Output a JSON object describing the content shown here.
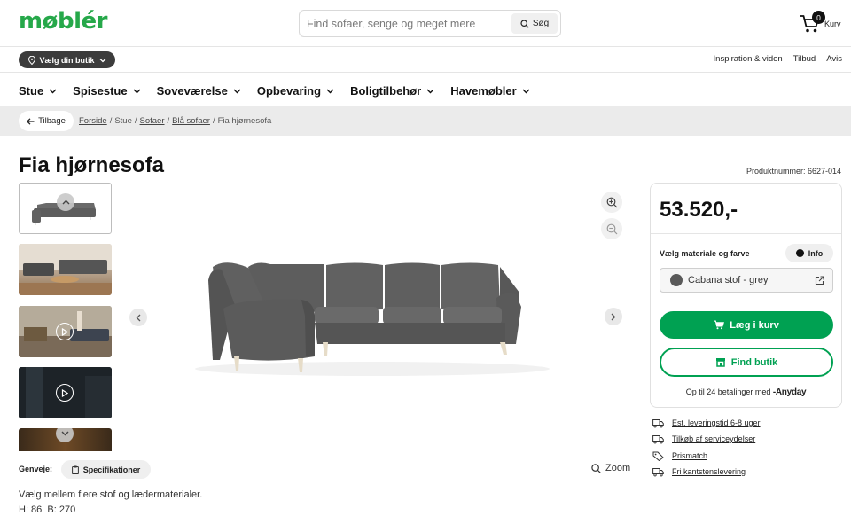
{
  "header": {
    "logo": "møblér",
    "search_placeholder": "Find sofaer, senge og meget mere",
    "search_button": "Søg",
    "cart_count": "0",
    "cart_label": "Kurv"
  },
  "subbar": {
    "store_button": "Vælg din butik",
    "links": [
      "Inspiration & viden",
      "Tilbud",
      "Avis"
    ]
  },
  "nav": [
    "Stue",
    "Spisestue",
    "Soveværelse",
    "Opbevaring",
    "Boligtilbehør",
    "Havemøbler"
  ],
  "breadcrumb": {
    "back": "Tilbage",
    "items": [
      "Forside",
      "Stue",
      "Sofaer",
      "Blå sofaer",
      "Fia hjørnesofa"
    ]
  },
  "product": {
    "title": "Fia hjørnesofa",
    "product_number": "Produktnummer: 6627-014",
    "price": "53.520,-",
    "material_label": "Vælg materiale og farve",
    "info_button": "Info",
    "material_name": "Cabana stof - grey",
    "add_to_cart": "Læg i kurv",
    "find_store": "Find butik",
    "financing_text": "Op til 24 betalinger med",
    "financing_brand": "Anyday",
    "description": "Vælg mellem flere stof og lædermaterialer.",
    "dimensions": "H: 86  B: 270"
  },
  "services": [
    "Est. leveringstid 6-8 uger",
    "Tilkøb af serviceydelser",
    "Prismatch",
    "Fri kantstenslevering"
  ],
  "shortcuts": {
    "label": "Genveje:",
    "spec_button": "Specifikationer",
    "zoom": "Zoom"
  },
  "colors": {
    "brand_green": "#26a84a",
    "cta_green": "#00a152",
    "sofa_grey": "#5a5a5a"
  }
}
